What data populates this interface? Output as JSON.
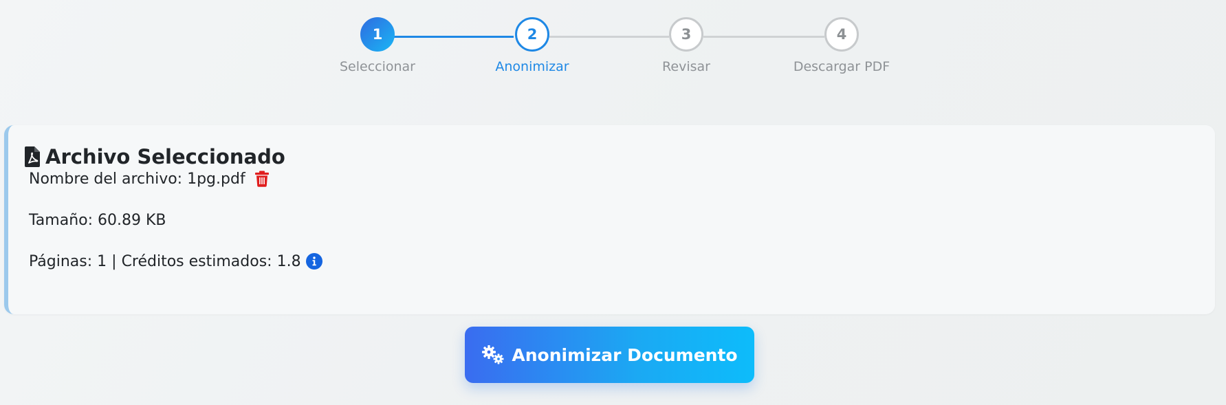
{
  "stepper": {
    "steps": [
      {
        "number": "1",
        "label": "Seleccionar",
        "state": "completed"
      },
      {
        "number": "2",
        "label": "Anonimizar",
        "state": "active"
      },
      {
        "number": "3",
        "label": "Revisar",
        "state": "pending"
      },
      {
        "number": "4",
        "label": "Descargar PDF",
        "state": "pending"
      }
    ]
  },
  "file_card": {
    "title": "Archivo Seleccionado",
    "title_icon": "file-pdf-icon",
    "filename_label": "Nombre del archivo:",
    "filename": "1pg.pdf",
    "delete_icon": "trash-icon",
    "size_label": "Tamaño:",
    "size_value": "60.89 KB",
    "pages_label": "Páginas:",
    "pages_value": "1",
    "separator": "|",
    "credits_label": "Créditos estimados:",
    "credits_value": "1.8",
    "info_icon": "info-icon"
  },
  "action": {
    "label": "Anonimizar Documento",
    "icon": "gears-icon"
  },
  "colors": {
    "accent": "#1e88e5",
    "delete": "#e01e1e",
    "info": "#1565e0",
    "card_border": "#9cc9ec",
    "button_start": "#3a6cf0",
    "button_end": "#0dbcfb"
  }
}
